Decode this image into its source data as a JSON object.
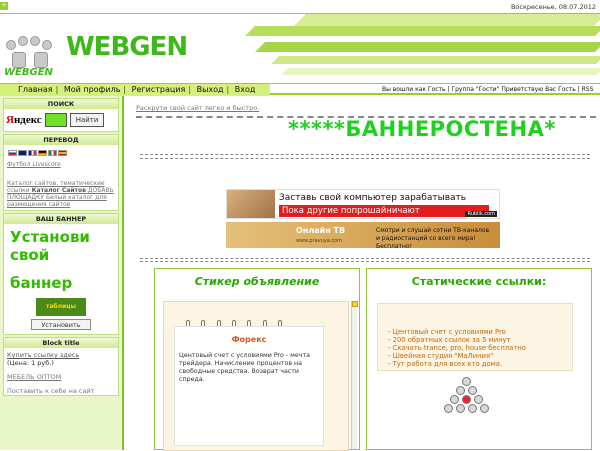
{
  "topbar": {
    "date": "Воскресенье, 08.07.2012"
  },
  "header": {
    "brand": "WEBGEN",
    "brand_small": "WEBGEN"
  },
  "nav": {
    "items": [
      "Главная",
      "Мой профиль",
      "Регистрация",
      "Выход",
      "Вход"
    ]
  },
  "userinfo": {
    "text": "Вы вошли как Гость | Группа \"Гости\" Приветствую Вас Гость | RSS"
  },
  "sidebar": {
    "search": {
      "title": "ПОИСК",
      "engine": "Яндекс",
      "button": "Найти"
    },
    "translate": {
      "title": "ПЕРЕВОД",
      "link": "Футбол Livescore"
    },
    "catalog": {
      "text1": "Каталог сайтов, тематические ссылки",
      "bold": "Каталог Сайтов",
      "text2": "ДОБАВЬ ПЛОЩАДКУ",
      "text3": "Белый каталог для размещения сайтов"
    },
    "banner": {
      "title": "ВАШ БАННЕР",
      "line1": "Установи свой",
      "line2": "баннер",
      "img": "таблицы",
      "button": "Установить"
    },
    "block": {
      "title": "Block title",
      "link": "Купить ссылку здесь",
      "price": "(Цена: 1 руб.)",
      "link2": "МЕБЕЛЬ ОПТОМ",
      "link3": "Поставить к себе на сайт"
    }
  },
  "main": {
    "tagline": "Раскрути свой сайт легко и быстро.",
    "title": "*****БАННЕРОСТЕНА*",
    "ad1": {
      "line1": "Заставь свой компьютер зарабатывать",
      "line2": "Пока другие попрошайничают",
      "brand": "Rublik.com"
    },
    "ad2": {
      "line1": "Онлайн ТВ",
      "line2": "www.pravuya.com",
      "line3": "Смотри и слушай сотни ТВ-каналов и радиостанций со всего мира! Бесплатно!"
    },
    "sticker": {
      "title": "Стикер объявление",
      "note_title": "Форекс",
      "note_body": "Центовый счет с условиями Pro - мечта трейдера. Начисление процентов на свободные средства. Возврат части спреда."
    },
    "static": {
      "title": "Статические ссылки:",
      "items": [
        "- Центовый счет с условиями Pro",
        "- 200 обратных ссылок за 5 минут",
        "- Скачать trance, pro, house бесплатно",
        "- Швейная студия \"МаЛиния\"",
        "- Тут работа для всех кто дома."
      ]
    }
  }
}
